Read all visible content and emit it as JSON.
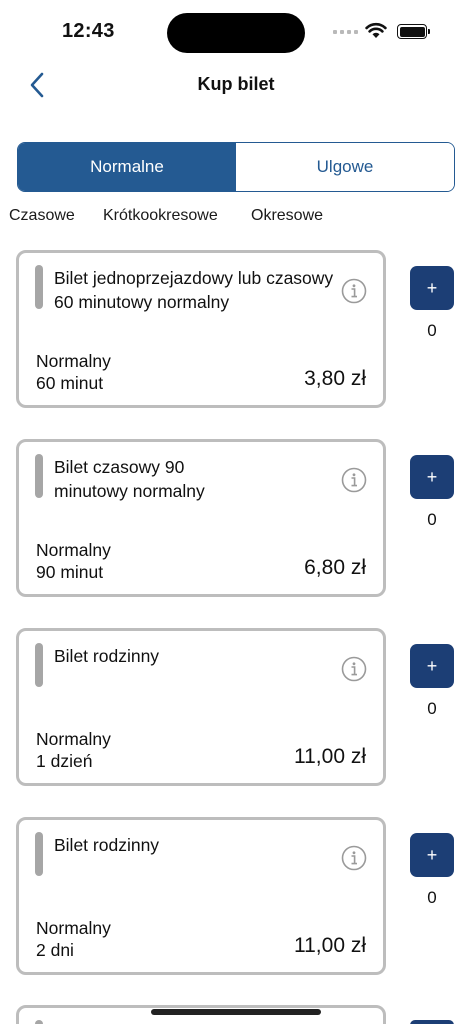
{
  "status_bar": {
    "time": "12:43"
  },
  "nav": {
    "title": "Kup bilet"
  },
  "segments": [
    {
      "label": "Normalne",
      "active": true
    },
    {
      "label": "Ulgowe",
      "active": false
    }
  ],
  "categories": [
    "Czasowe",
    "Krótkookresowe",
    "Okresowe"
  ],
  "tickets": [
    {
      "title": "Bilet jednoprzejazdowy lub czasowy 60 minutowy normalny",
      "type": "Normalny",
      "duration": "60 minut",
      "price": "3,80 zł",
      "quantity": "0",
      "add_label": "+"
    },
    {
      "title": "Bilet czasowy 90 minutowy normalny",
      "type": "Normalny",
      "duration": "90 minut",
      "price": "6,80 zł",
      "quantity": "0",
      "add_label": "+"
    },
    {
      "title": "Bilet rodzinny",
      "type": "Normalny",
      "duration": "1 dzień",
      "price": "11,00 zł",
      "quantity": "0",
      "add_label": "+"
    },
    {
      "title": "Bilet rodzinny",
      "type": "Normalny",
      "duration": "2 dni",
      "price": "11,00 zł",
      "quantity": "0",
      "add_label": "+"
    }
  ],
  "colors": {
    "primary": "#245a92",
    "button": "#1c3e75",
    "card_border": "#bdbdbd",
    "accent_bar": "#a6a6a6"
  },
  "icons": {
    "back": "chevron-left-icon",
    "info": "info-circle-icon"
  }
}
